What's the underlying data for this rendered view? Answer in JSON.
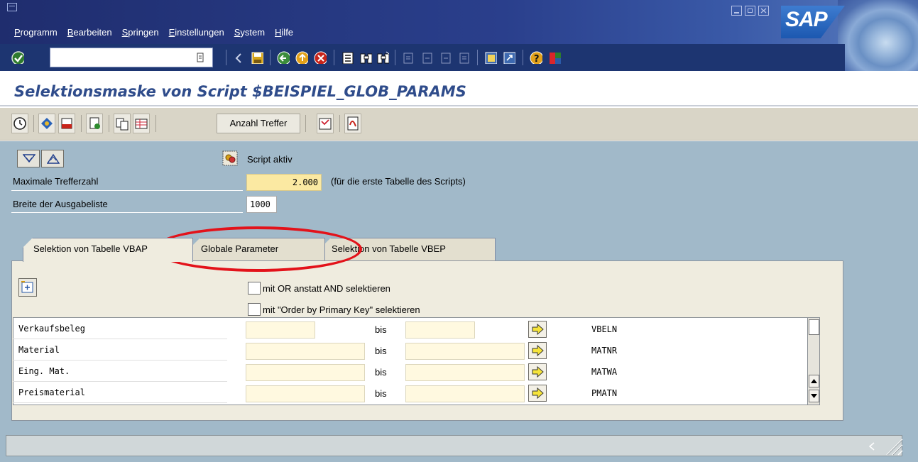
{
  "menu": {
    "items": [
      "Programm",
      "Bearbeiten",
      "Springen",
      "Einstellungen",
      "System",
      "Hilfe"
    ]
  },
  "brand": {
    "logo_text": "SAP"
  },
  "title": "Selektionsmaske von Script $BEISPIEL_GLOB_PARAMS",
  "app_toolbar": {
    "hits_button": "Anzahl Treffer"
  },
  "header": {
    "script_active": "Script aktiv",
    "max_hits_label": "Maximale Trefferzahl",
    "max_hits_value": "2.000",
    "max_hits_note": "(für die erste Tabelle des Scripts)",
    "width_label": "Breite der Ausgabeliste",
    "width_value": "1000"
  },
  "tabs": [
    {
      "label": "Selektion von Tabelle VBAP",
      "active": true
    },
    {
      "label": "Globale Parameter",
      "active": false
    },
    {
      "label": "Selektion von Tabelle VBEP",
      "active": false
    }
  ],
  "options": {
    "or_select": "mit OR anstatt AND selektieren",
    "order_by_pk": "mit \"Order by Primary Key\" selektieren"
  },
  "rows": [
    {
      "label": "Verkaufsbeleg",
      "bis": "bis",
      "field": "VBELN"
    },
    {
      "label": "Material",
      "bis": "bis",
      "field": "MATNR"
    },
    {
      "label": "Eing. Mat.",
      "bis": "bis",
      "field": "MATWA"
    },
    {
      "label": "Preismaterial",
      "bis": "bis",
      "field": "PMATN"
    }
  ],
  "colors": {
    "title_blue": "#2f4c8b",
    "required_field": "#fbe9a2",
    "annotation": "#e3121a",
    "screen_bg": "#a1b9c9"
  }
}
